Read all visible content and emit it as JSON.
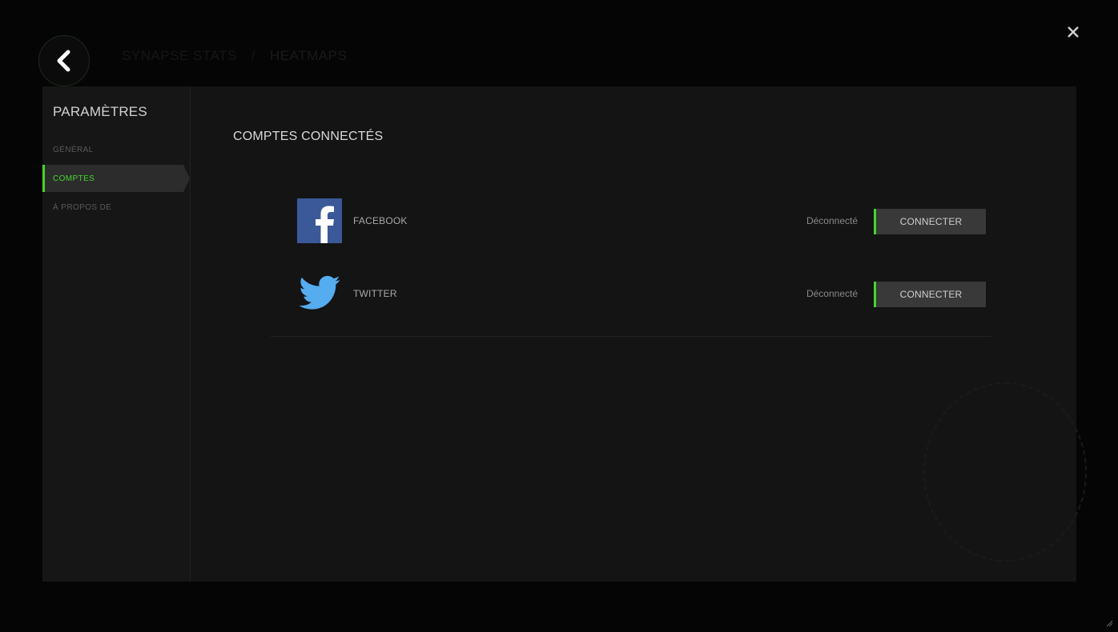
{
  "header": {
    "breadcrumb_prev": "SYNAPSE STATS",
    "breadcrumb_separator": "/",
    "breadcrumb_current": "HEATMAPS",
    "back_icon": "chevron-left-icon",
    "close_icon": "close-icon"
  },
  "sidebar": {
    "title": "PARAMÈTRES",
    "items": [
      {
        "label": "GÉNÉRAL",
        "active": false
      },
      {
        "label": "COMPTES",
        "active": true
      },
      {
        "label": "À PROPOS DE",
        "active": false
      }
    ]
  },
  "content": {
    "title": "COMPTES CONNECTÉS",
    "accounts": [
      {
        "name": "FACEBOOK",
        "icon": "facebook-icon",
        "status": "Déconnecté",
        "action": "CONNECTER"
      },
      {
        "name": "TWITTER",
        "icon": "twitter-icon",
        "status": "Déconnecté",
        "action": "CONNECTER"
      }
    ]
  },
  "colors": {
    "accent": "#44d62c",
    "background": "#050505",
    "panel": "#141414",
    "facebook": "#3b5998",
    "twitter": "#55acee"
  }
}
